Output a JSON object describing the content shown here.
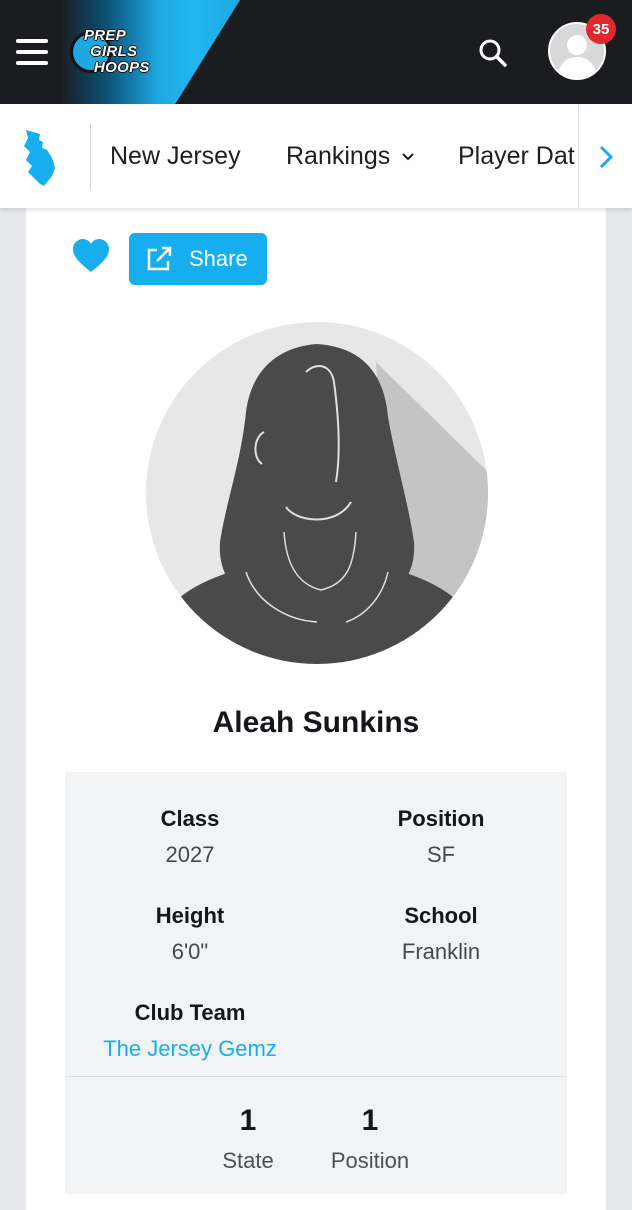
{
  "header": {
    "logo_lines": [
      "PREP",
      "GIRLS",
      "HOOPS"
    ],
    "notification_count": "35",
    "icons": [
      "menu-icon",
      "search-icon",
      "user-avatar-icon"
    ]
  },
  "subnav": {
    "state_icon": "new-jersey-map-icon",
    "items": [
      {
        "label": "New Jersey"
      },
      {
        "label": "Rankings"
      },
      {
        "label": "Player Dat"
      }
    ]
  },
  "actions": {
    "favorite_icon": "heart-icon",
    "share_label": "Share"
  },
  "player": {
    "name": "Aleah Sunkins",
    "details": {
      "class_label": "Class",
      "class_value": "2027",
      "position_label": "Position",
      "position_value": "SF",
      "height_label": "Height",
      "height_value": "6'0\"",
      "school_label": "School",
      "school_value": "Franklin",
      "club_label": "Club Team",
      "club_value": "The Jersey Gemz"
    },
    "rankings": [
      {
        "rank": "1",
        "label": "State"
      },
      {
        "rank": "1",
        "label": "Position"
      }
    ]
  },
  "colors": {
    "accent": "#17aef0",
    "header_bg": "#1b1c20",
    "badge": "#e0282e"
  }
}
